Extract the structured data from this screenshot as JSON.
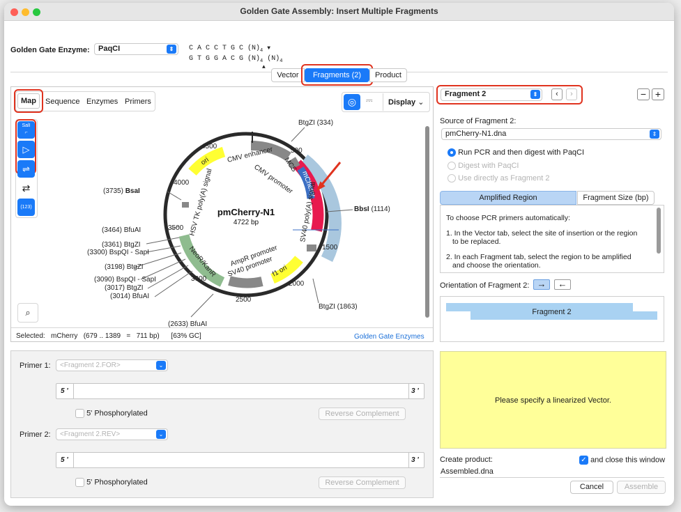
{
  "window": {
    "title": "Golden Gate Assembly: Insert Multiple Fragments"
  },
  "enzyme": {
    "label": "Golden Gate Enzyme:",
    "value": "PaqCI",
    "site_top": "C A C C T G C (N)",
    "site_top_sub": "4",
    "site_bottom": "G T G G A C G (N)",
    "site_bottom_sub": "4",
    "site_bottom_tail": "(N)",
    "site_bottom_tail_sub": "4"
  },
  "tabs": {
    "vector": "Vector",
    "fragments": "Fragments (2)",
    "product": "Product"
  },
  "map": {
    "view_tabs": [
      "Map",
      "Sequence",
      "Enzymes",
      "Primers"
    ],
    "display_label": "Display",
    "plasmid_name": "pmCherry-N1",
    "plasmid_size": "4722 bp",
    "tool_labels": {
      "sall": "SalI",
      "count": "(123)"
    },
    "ring_ticks": [
      "500",
      "1000",
      "1500",
      "2000",
      "2500",
      "3000",
      "3500",
      "4000",
      "4500"
    ],
    "features": [
      "ori",
      "CMV enhancer",
      "CMV promoter",
      "MCS",
      "mCherry",
      "SV40 poly(A) signal",
      "f1 ori",
      "SV40 promoter",
      "AmpR promoter",
      "NeoR/KanR",
      "HSV TK poly(A) signal"
    ],
    "sites": [
      {
        "pos": "(334)",
        "name": "BtgZI"
      },
      {
        "pos": "(1114)",
        "name": "BbsI"
      },
      {
        "pos": "(1863)",
        "name": "BtgZI"
      },
      {
        "pos": "(3735)",
        "name": "BsaI"
      },
      {
        "pos": "(3464)",
        "name": "BfuAI"
      },
      {
        "pos": "(3361)",
        "name": "BtgZI"
      },
      {
        "pos": "(3300)",
        "name": "BspQI - SapI"
      },
      {
        "pos": "(3198)",
        "name": "BtgZI"
      },
      {
        "pos": "(3090)",
        "name": "BspQI - SapI"
      },
      {
        "pos": "(3017)",
        "name": "BtgZI"
      },
      {
        "pos": "(3014)",
        "name": "BfuAI"
      },
      {
        "pos": "(2633)",
        "name": "BfuAI"
      }
    ],
    "status": "Selected:   mCherry   (679 .. 1389   =   711 bp)      [63% GC]",
    "status_link": "Golden Gate Enzymes"
  },
  "primers": {
    "p1_label": "Primer 1:",
    "p1_placeholder": "<Fragment 2.FOR>",
    "p2_label": "Primer 2:",
    "p2_placeholder": "<Fragment 2.REV>",
    "five": "5 '",
    "three": "3 '",
    "phos": "5' Phosphorylated",
    "revcomp": "Reverse Complement"
  },
  "right": {
    "fragment_select": "Fragment 2",
    "source_label": "Source of Fragment 2:",
    "source_value": "pmCherry-N1.dna",
    "opt_run": "Run PCR and then digest with PaqCI",
    "opt_digest": "Digest with PaqCI",
    "opt_direct": "Use directly as Fragment 2",
    "seg_amplified": "Amplified Region",
    "seg_size": "Fragment Size (bp)",
    "info_lines": [
      "To choose PCR primers automatically:",
      "1. In the Vector tab, select the site of insertion or the region",
      "to be replaced.",
      "2. In each Fragment tab, select the region to be amplified",
      "and choose the orientation."
    ],
    "orientation_label": "Orientation of Fragment 2:",
    "fragment_bar": "Fragment 2",
    "message": "Please specify a linearized Vector.",
    "create_label": "Create product:",
    "close_label": "and close this window",
    "product_name": "Assembled.dna",
    "cancel": "Cancel",
    "assemble": "Assemble"
  },
  "colors": {
    "accent": "#1a7af8",
    "highlight": "#e0331f",
    "yellow": "#ffff99"
  }
}
